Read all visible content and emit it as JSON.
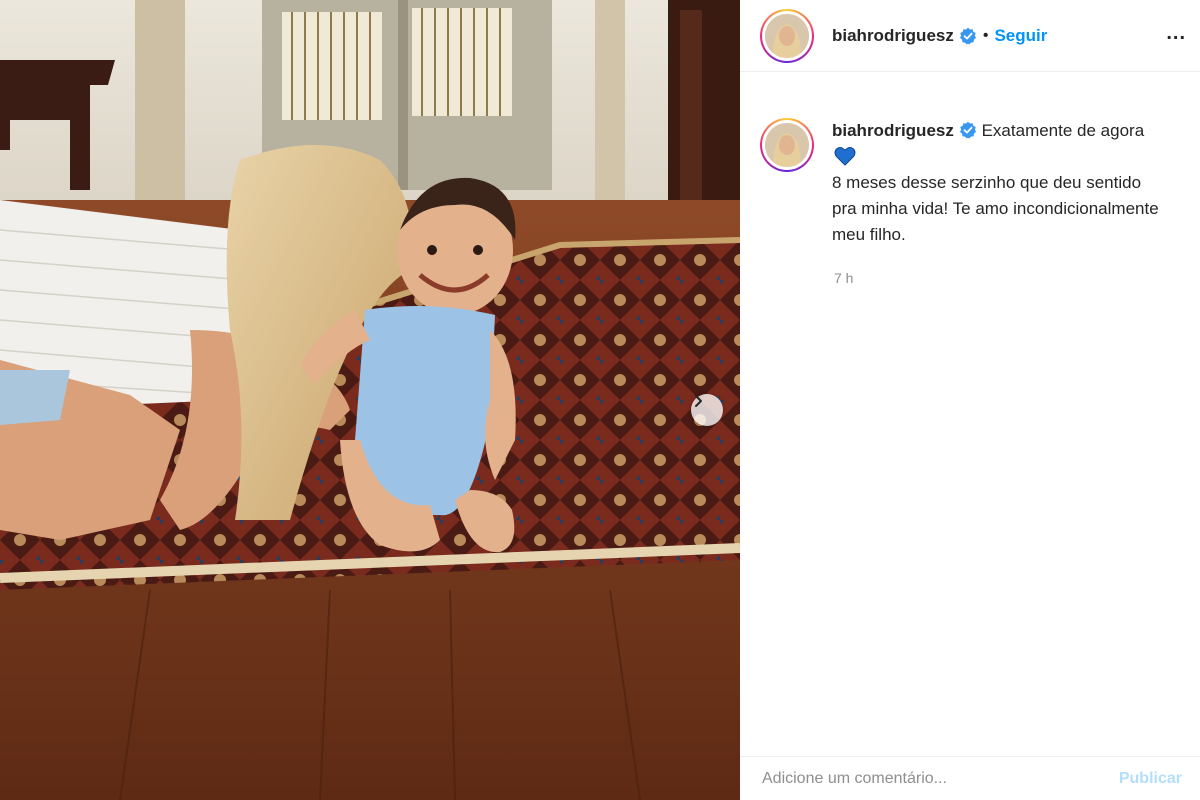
{
  "post": {
    "image_alt": "Foto de uma mulher beijando a cabeça de um bebê sorridente sentado sobre um tapete",
    "carousel_next_icon": "chevron-right-icon"
  },
  "header": {
    "username": "biahrodriguesz",
    "verified_icon": "verified-badge-icon",
    "separator": "•",
    "follow_label": "Seguir",
    "more_label": "..."
  },
  "caption": {
    "username": "biahrodriguesz",
    "text_line1": "Exatamente de agora",
    "emoji": "blue-heart-icon",
    "text_line2": "8 meses desse serzinho que deu sentido pra minha vida! Te amo incondicionalmente meu filho.",
    "timestamp": "7 h"
  },
  "comment_box": {
    "placeholder": "Adicione um comentário...",
    "publish_label": "Publicar"
  },
  "colors": {
    "link": "#0095f6",
    "publish_disabled": "#b2dffc",
    "verified": "#3897f0",
    "heart": "#1e6fd0"
  }
}
